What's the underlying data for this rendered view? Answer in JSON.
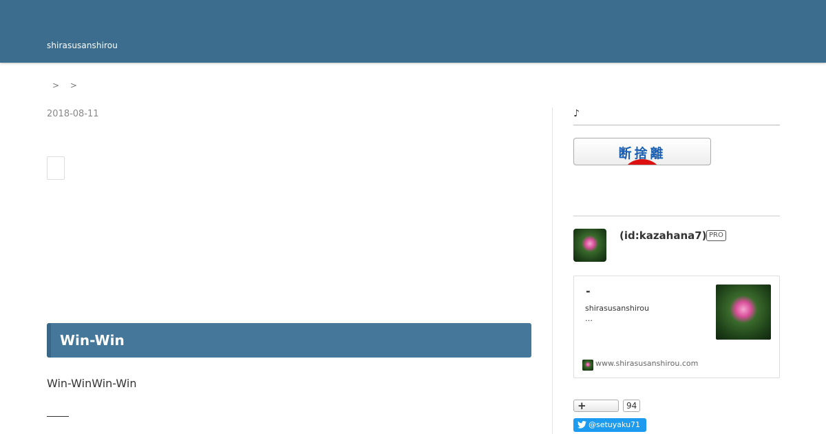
{
  "header": {
    "site_title": "shirasusanshirou"
  },
  "breadcrumb": {
    "separators": [
      ">",
      ">"
    ]
  },
  "entry": {
    "date": "2018-08-11",
    "heading": "Win-Win",
    "body_text": "Win-WinWin-Win"
  },
  "sidebar": {
    "section_heading": "♪",
    "banner_text": "断捨離",
    "profile": {
      "id_label": "(id:kazahana7)",
      "badge": "PRO"
    },
    "blog_card": {
      "title": "-",
      "site_name": "shirasusanshirou",
      "ellipsis": "…",
      "url": "www.shirasusanshirou.com"
    },
    "bookmark": {
      "count": "94",
      "icon": "plus-icon"
    },
    "twitter": {
      "handle": "@setuyaku71",
      "icon": "twitter-bird-icon"
    }
  },
  "colors": {
    "header_bg": "#3c6d8e",
    "heading_bg": "#44779a",
    "twitter_blue": "#1d9bf0",
    "banner_text": "#1a5fb4",
    "banner_sun": "#dd1111"
  }
}
